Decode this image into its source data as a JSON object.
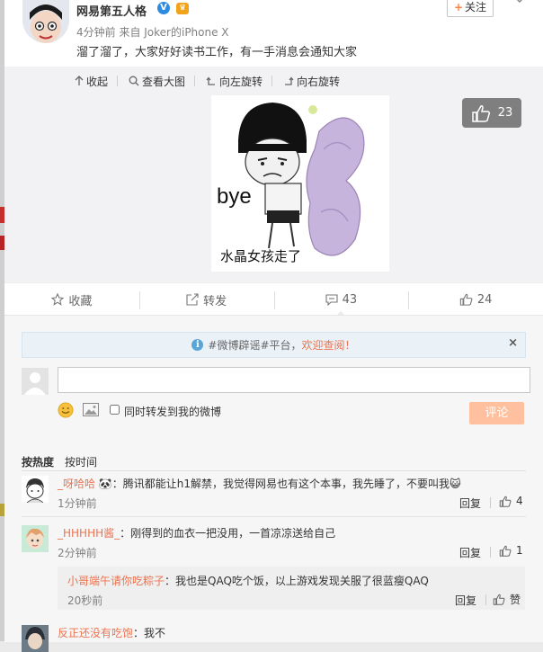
{
  "post": {
    "author_name": "网易第五人格",
    "verified_badge": "V",
    "member_badge": "👑",
    "follow_label": "关注",
    "follow_plus": "+",
    "meta": "4分钟前 来自 Joker的iPhone X",
    "text": "溜了溜了，大家好好读书工作，有一手消息会通知大家"
  },
  "media_toolbar": {
    "collapse": "收起",
    "view_large": "查看大图",
    "rotate_left": "向左旋转",
    "rotate_right": "向右旋转"
  },
  "meme": {
    "bye_text": "bye",
    "caption": "水晶女孩走了"
  },
  "like_overlay_count": "23",
  "actions": {
    "favorite": "收藏",
    "repost": "转发",
    "comment_count": "43",
    "like_count": "24"
  },
  "notice": {
    "prefix": "#微博辟谣#平台，",
    "link": "欢迎查阅！",
    "close": "×"
  },
  "composer": {
    "input_value": "",
    "repost_label": "同时转发到我的微博",
    "submit_label": "评论"
  },
  "sort_tabs": [
    "按热度",
    "按时间"
  ],
  "comments": [
    {
      "user": "_呀哈哈",
      "user_emoji": "🐼",
      "text": "：腾讯都能让h1解禁，我觉得网易也有这个本事，我先睡了，不要叫我",
      "tail_emoji": "😺",
      "time": "1分钟前",
      "reply_label": "回复",
      "likes": "4"
    },
    {
      "user": "_HHHHH酱_",
      "text": "：刚得到的血衣一把没用，一首凉凉送给自己",
      "time": "2分钟前",
      "reply_label": "回复",
      "likes": "1"
    },
    {
      "user": "反正还没有吃饱",
      "text": "：我不"
    }
  ],
  "sub_reply": {
    "user": "小哥端午请你吃粽子",
    "text": "：我也是QAQ吃个饭，以上游戏发现关服了很蓝瘦QAQ",
    "time": "20秒前",
    "reply_label": "回复",
    "like_label": "赞"
  },
  "colors": {
    "accent_orange": "#eb7350",
    "verified_blue": "#2d8be0",
    "submit_disabled": "#ffc09f",
    "overlay_gray": "#7f7f7f",
    "media_bg": "#f2f2f5"
  }
}
